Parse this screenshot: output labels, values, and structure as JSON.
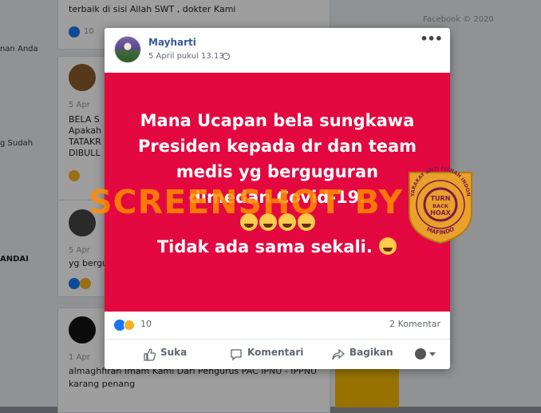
{
  "background": {
    "top_text_1": "terbaik di sisi Allah SWT , dokter Kami",
    "top_count": "10",
    "left_label_1": "nan Anda",
    "left_label_2": "g Sudah",
    "left_label_3": "ANDAI",
    "bg_date_1": "5 Apr",
    "bg_post_1_line1": "BELA S",
    "bg_post_1_line2": "Apakah",
    "bg_post_1_line3": "TATAKR",
    "bg_post_1_line4": "DIBULL",
    "bg_date_2": "5 Apr",
    "bg_post_2_line1": "yg bergu",
    "bg_date_3": "1 Apr",
    "bg_bottom_line1": "almaghfirah Imam Kami Dari Pengurus PAC IPNU - IPPNU",
    "bg_bottom_line2": "karang penang",
    "right_footer": "Facebook © 2020"
  },
  "post": {
    "author": "Mayharti",
    "timestamp": "5 April pukul 13.13 ·",
    "menu_icon": "more-options-icon",
    "banner_color": "#e3083f",
    "banner_lines": [
      "Mana Ucapan bela sungkawa",
      "Presiden kepada dr dan team",
      "medis yg berguguran",
      "dimedan Covid-19."
    ],
    "banner_last_line": "Tidak ada sama sekali.",
    "watermark": "SCREENSHOT BY",
    "seal_text_top": "MASYARAKAT ANTI FITNAH INDONESIA",
    "seal_text_center": "TURN BACK HOAX",
    "seal_text_bottom": "MAFINDO",
    "reaction_count": "10",
    "comment_count": "2 Komentar",
    "actions": {
      "like": "Suka",
      "comment": "Komentari",
      "share": "Bagikan"
    }
  }
}
